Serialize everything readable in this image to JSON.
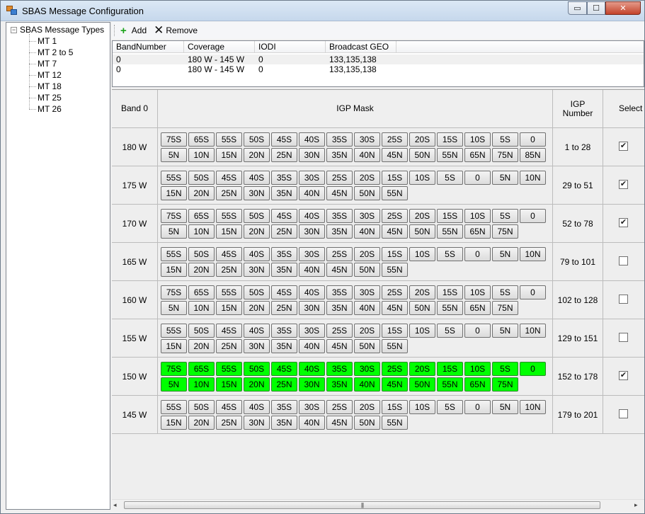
{
  "window": {
    "title": "SBAS Message Configuration",
    "min_glyph": "▭",
    "max_glyph": "☐",
    "close_glyph": "✕"
  },
  "tree": {
    "root": "SBAS Message Types",
    "expander": "−",
    "items": [
      "MT 1",
      "MT 2 to 5",
      "MT 7",
      "MT 12",
      "MT 18",
      "MT 25",
      "MT 26"
    ]
  },
  "toolbar": {
    "add_label": "Add",
    "remove_label": "Remove",
    "add_icon": "+",
    "remove_icon": "✕"
  },
  "list": {
    "columns": [
      "BandNumber",
      "Coverage",
      "IODI",
      "Broadcast GEO"
    ],
    "rows": [
      [
        "0",
        "180 W - 145 W",
        "0",
        "133,135,138"
      ],
      [
        "0",
        "180 W - 145 W",
        "0",
        "133,135,138"
      ]
    ]
  },
  "grid": {
    "headers": {
      "band": "Band 0",
      "mask": "IGP Mask",
      "igp_number": "IGP\nNumber",
      "select": "Select"
    },
    "rows": [
      {
        "band": "180 W",
        "line1": [
          "75S",
          "65S",
          "55S",
          "50S",
          "45S",
          "40S",
          "35S",
          "30S",
          "25S",
          "20S",
          "15S",
          "10S",
          "5S",
          "0"
        ],
        "line2": [
          "5N",
          "10N",
          "15N",
          "20N",
          "25N",
          "30N",
          "35N",
          "40N",
          "45N",
          "50N",
          "55N",
          "65N",
          "75N",
          "85N"
        ],
        "igp": "1 to 28",
        "checked": true,
        "highlight": false
      },
      {
        "band": "175 W",
        "line1": [
          "55S",
          "50S",
          "45S",
          "40S",
          "35S",
          "30S",
          "25S",
          "20S",
          "15S",
          "10S",
          "5S",
          "0",
          "5N",
          "10N"
        ],
        "line2": [
          "15N",
          "20N",
          "25N",
          "30N",
          "35N",
          "40N",
          "45N",
          "50N",
          "55N"
        ],
        "igp": "29 to 51",
        "checked": true,
        "highlight": false
      },
      {
        "band": "170 W",
        "line1": [
          "75S",
          "65S",
          "55S",
          "50S",
          "45S",
          "40S",
          "35S",
          "30S",
          "25S",
          "20S",
          "15S",
          "10S",
          "5S",
          "0"
        ],
        "line2": [
          "5N",
          "10N",
          "15N",
          "20N",
          "25N",
          "30N",
          "35N",
          "40N",
          "45N",
          "50N",
          "55N",
          "65N",
          "75N"
        ],
        "igp": "52 to 78",
        "checked": true,
        "highlight": false
      },
      {
        "band": "165 W",
        "line1": [
          "55S",
          "50S",
          "45S",
          "40S",
          "35S",
          "30S",
          "25S",
          "20S",
          "15S",
          "10S",
          "5S",
          "0",
          "5N",
          "10N"
        ],
        "line2": [
          "15N",
          "20N",
          "25N",
          "30N",
          "35N",
          "40N",
          "45N",
          "50N",
          "55N"
        ],
        "igp": "79 to 101",
        "checked": false,
        "highlight": false
      },
      {
        "band": "160 W",
        "line1": [
          "75S",
          "65S",
          "55S",
          "50S",
          "45S",
          "40S",
          "35S",
          "30S",
          "25S",
          "20S",
          "15S",
          "10S",
          "5S",
          "0"
        ],
        "line2": [
          "5N",
          "10N",
          "15N",
          "20N",
          "25N",
          "30N",
          "35N",
          "40N",
          "45N",
          "50N",
          "55N",
          "65N",
          "75N"
        ],
        "igp": "102 to 128",
        "checked": false,
        "highlight": false
      },
      {
        "band": "155 W",
        "line1": [
          "55S",
          "50S",
          "45S",
          "40S",
          "35S",
          "30S",
          "25S",
          "20S",
          "15S",
          "10S",
          "5S",
          "0",
          "5N",
          "10N"
        ],
        "line2": [
          "15N",
          "20N",
          "25N",
          "30N",
          "35N",
          "40N",
          "45N",
          "50N",
          "55N"
        ],
        "igp": "129 to 151",
        "checked": false,
        "highlight": false
      },
      {
        "band": "150 W",
        "line1": [
          "75S",
          "65S",
          "55S",
          "50S",
          "45S",
          "40S",
          "35S",
          "30S",
          "25S",
          "20S",
          "15S",
          "10S",
          "5S",
          "0"
        ],
        "line2": [
          "5N",
          "10N",
          "15N",
          "20N",
          "25N",
          "30N",
          "35N",
          "40N",
          "45N",
          "50N",
          "55N",
          "65N",
          "75N"
        ],
        "igp": "152 to 178",
        "checked": true,
        "highlight": true
      },
      {
        "band": "145 W",
        "line1": [
          "55S",
          "50S",
          "45S",
          "40S",
          "35S",
          "30S",
          "25S",
          "20S",
          "15S",
          "10S",
          "5S",
          "0",
          "5N",
          "10N"
        ],
        "line2": [
          "15N",
          "20N",
          "25N",
          "30N",
          "35N",
          "40N",
          "45N",
          "50N",
          "55N"
        ],
        "igp": "179 to 201",
        "checked": false,
        "highlight": false
      }
    ]
  },
  "scrollbar": {
    "left_arrow": "◂",
    "right_arrow": "▸",
    "thumb_grip": "|||"
  },
  "colors": {
    "highlight": "#00ff00"
  }
}
